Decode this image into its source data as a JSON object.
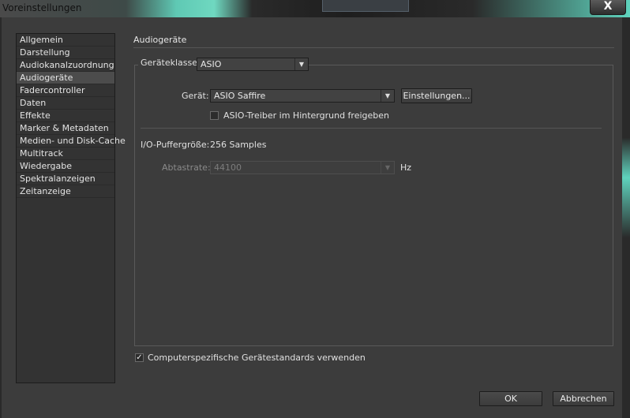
{
  "window": {
    "title": "Voreinstellungen",
    "close_label": "X"
  },
  "sidebar": {
    "selected_index": 3,
    "items": [
      {
        "label": "Allgemein"
      },
      {
        "label": "Darstellung"
      },
      {
        "label": "Audiokanalzuordnung"
      },
      {
        "label": "Audiogeräte"
      },
      {
        "label": "Fadercontroller"
      },
      {
        "label": "Daten"
      },
      {
        "label": "Effekte"
      },
      {
        "label": "Marker & Metadaten"
      },
      {
        "label": "Medien- und Disk-Cache"
      },
      {
        "label": "Multitrack"
      },
      {
        "label": "Wiedergabe"
      },
      {
        "label": "Spektralanzeigen"
      },
      {
        "label": "Zeitanzeige"
      }
    ]
  },
  "main": {
    "section_title": "Audiogeräte",
    "device_class_label": "Geräteklasse:",
    "device_class_value": "ASIO",
    "device_label": "Gerät:",
    "device_value": "ASIO Saffire",
    "settings_button": "Einstellungen...",
    "background_checkbox_label": "ASIO-Treiber im Hintergrund freigeben",
    "background_checkbox_checked": false,
    "buffer_size_label": "I/O-Puffergröße:",
    "buffer_size_value": "256 Samples",
    "sample_rate_label": "Abtastrate:",
    "sample_rate_value": "44100",
    "sample_rate_unit": "Hz",
    "computer_defaults_label": "Computerspezifische Gerätestandards verwenden",
    "computer_defaults_checked": true
  },
  "footer": {
    "ok_label": "OK",
    "cancel_label": "Abbrechen"
  },
  "icons": {
    "dropdown_arrow": "chevron-down-icon",
    "checkmark": "check-icon",
    "close": "close-icon"
  }
}
